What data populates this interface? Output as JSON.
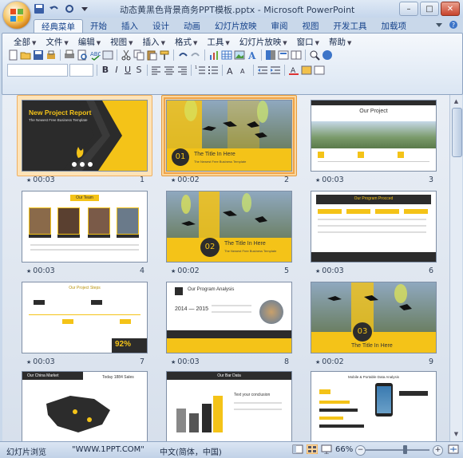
{
  "window": {
    "title": "动态黄黑色背景商务PPT模板.pptx - Microsoft PowerPoint",
    "controls": {
      "minimize": "–",
      "maximize": "□",
      "close": "✕"
    }
  },
  "ribbon_tabs": [
    "经典菜单",
    "开始",
    "插入",
    "设计",
    "动画",
    "幻灯片放映",
    "审阅",
    "视图",
    "开发工具",
    "加载项"
  ],
  "active_tab": "经典菜单",
  "menus": [
    "全部",
    "文件",
    "编辑",
    "视图",
    "插入",
    "格式",
    "工具",
    "幻灯片放映",
    "窗口",
    "帮助"
  ],
  "slides": [
    {
      "number": "1",
      "timing": "00:03",
      "title": "New Project Report",
      "subtitle": "The Newest Free Business Template"
    },
    {
      "number": "2",
      "timing": "00:02",
      "badge": "01",
      "title": "The Title In Here",
      "subtitle": "The Newest Free Business Template"
    },
    {
      "number": "3",
      "timing": "00:03",
      "title": "Our Project"
    },
    {
      "number": "4",
      "timing": "00:03",
      "title": "Our Team"
    },
    {
      "number": "5",
      "timing": "00:02",
      "badge": "02",
      "title": "The Title In Here",
      "subtitle": "The Newest Free Business Template"
    },
    {
      "number": "6",
      "timing": "00:03",
      "title": "Our Program Procced"
    },
    {
      "number": "7",
      "timing": "00:03",
      "title": "Our Project Steps",
      "stat": "92%"
    },
    {
      "number": "8",
      "timing": "00:03",
      "title": "Our Program Analysis",
      "years": "2014 — 2015"
    },
    {
      "number": "9",
      "timing": "00:02",
      "badge": "03",
      "title": "The Title In Here"
    },
    {
      "number": "10",
      "title": "Our China Market",
      "stat": "Today 1884 Sales"
    },
    {
      "number": "11",
      "title": "Our Bar Data",
      "caption": "Text your conclusion"
    },
    {
      "number": "12",
      "title": "Mobile & Portable  Data Analysis"
    }
  ],
  "status": {
    "view_name": "幻灯片浏览",
    "theme": "\"WWW.1PPT.COM\"",
    "language": "中文(简体，中国)",
    "zoom": "66%",
    "zoom_level": 0.66,
    "zoom_out": "−",
    "zoom_in": "+"
  },
  "colors": {
    "accent_yellow": "#f4c318",
    "selection": "#fbd79d",
    "dark": "#2c2c2c"
  }
}
